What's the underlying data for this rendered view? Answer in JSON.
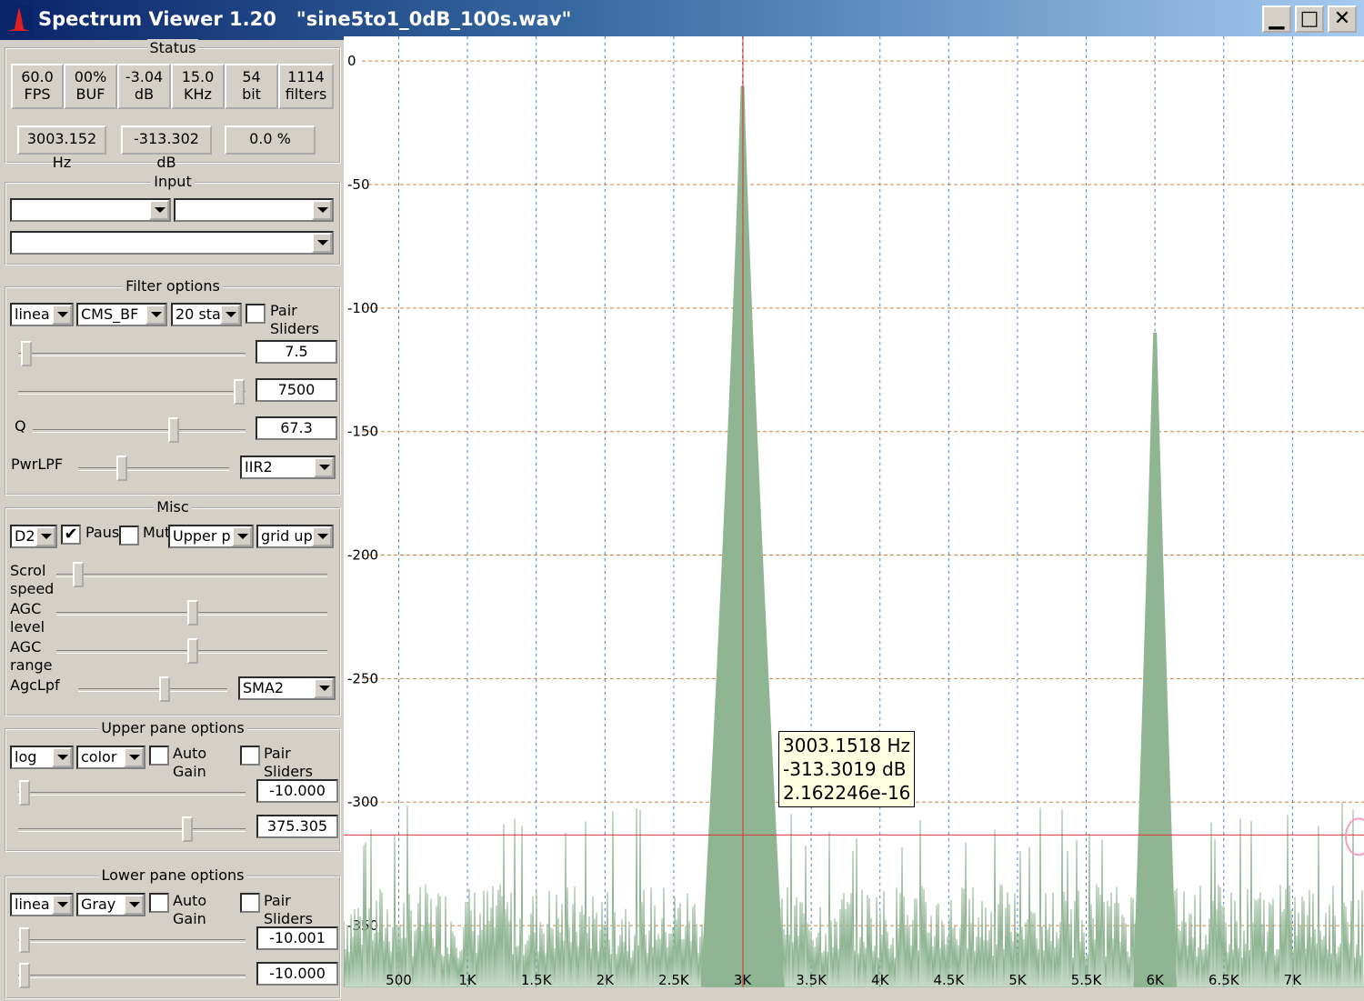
{
  "window": {
    "title": "Spectrum Viewer 1.20   \"sine5to1_0dB_100s.wav\""
  },
  "status": {
    "legend": "Status",
    "boxes": [
      {
        "line1": "60.0",
        "line2": "FPS"
      },
      {
        "line1": "00%",
        "line2": "BUF"
      },
      {
        "line1": "-3.04",
        "line2": "dB"
      },
      {
        "line1": "15.0",
        "line2": "KHz"
      },
      {
        "line1": "54",
        "line2": "bit"
      },
      {
        "line1": "1114",
        "line2": "filters"
      }
    ],
    "freq": "3003.152 Hz",
    "level": "-313.302 dB",
    "percent": "0.0 %"
  },
  "input": {
    "legend": "Input",
    "combo1": "",
    "combo2": "",
    "combo3": ""
  },
  "filter": {
    "legend": "Filter options",
    "combo_scale": "linea",
    "combo_type": "CMS_BF",
    "combo_stages": "20 sta",
    "pair_label1": "Pair",
    "pair_label2": "Sliders",
    "pair_checked": false,
    "slider1_value": "7.5",
    "slider2_value": "7500",
    "q_label": "Q",
    "q_value": "67.3",
    "pwr_label": "PwrLPF",
    "pwr_combo": "IIR2"
  },
  "misc": {
    "legend": "Misc",
    "combo_d": "D2",
    "pause_label": "Paus",
    "pause_checked": true,
    "mute_label": "Mut",
    "mute_checked": false,
    "combo_upper": "Upper p",
    "combo_grid": "grid up",
    "scroll_label1": "Scrol",
    "scroll_label2": "speed",
    "agc_level_label1": "AGC",
    "agc_level_label2": "level",
    "agc_range_label1": "AGC",
    "agc_range_label2": "range",
    "agclpf_label": "AgcLpf",
    "agclpf_combo": "SMA2"
  },
  "upper": {
    "legend": "Upper pane options",
    "combo_scale": "log",
    "combo_color": "color",
    "auto_label1": "Auto",
    "auto_label2": "Gain",
    "pair_label1": "Pair",
    "pair_label2": "Sliders",
    "value1": "-10.000",
    "value2": "375.305"
  },
  "lower": {
    "legend": "Lower pane options",
    "combo_scale": "linea",
    "combo_color": "Gray",
    "auto_label1": "Auto",
    "auto_label2": "Gain",
    "pair_label1": "Pair",
    "pair_label2": "Sliders",
    "value1": "-10.001",
    "value2": "-10.000"
  },
  "tooltip": {
    "line1": "3003.1518 Hz",
    "line2": "-313.3019 dB",
    "line3": "2.162246e-16"
  },
  "chart_data": {
    "type": "area",
    "x_tick_labels": [
      "500",
      "1K",
      "1.5K",
      "2K",
      "2.5K",
      "3K",
      "3.5K",
      "4K",
      "4.5K",
      "5K",
      "5.5K",
      "6K",
      "6.5K",
      "7K"
    ],
    "x_ticks_hz": [
      500,
      1000,
      1500,
      2000,
      2500,
      3000,
      3500,
      4000,
      4500,
      5000,
      5500,
      6000,
      6500,
      7000
    ],
    "y_tick_labels": [
      "0",
      "-50",
      "-100",
      "-150",
      "-200",
      "-250",
      "-300",
      "-350"
    ],
    "y_ticks_db": [
      0,
      -50,
      -100,
      -150,
      -200,
      -250,
      -300,
      -350
    ],
    "xlim": [
      100,
      7520
    ],
    "ylim": [
      -375,
      10
    ],
    "grid": true,
    "peaks": [
      {
        "freq_hz": 3000,
        "level_db": -10
      },
      {
        "freq_hz": 6000,
        "level_db": -110
      }
    ],
    "noise_floor_db": -345,
    "cursor": {
      "freq_hz": 3003.15,
      "level_db": -313.3
    },
    "colors": {
      "fill": "#8fb592",
      "vgrid": "#4a82c4",
      "hgrid": "#d2803a",
      "cursor": "#e03030",
      "marker": "#f0a0c0"
    }
  }
}
